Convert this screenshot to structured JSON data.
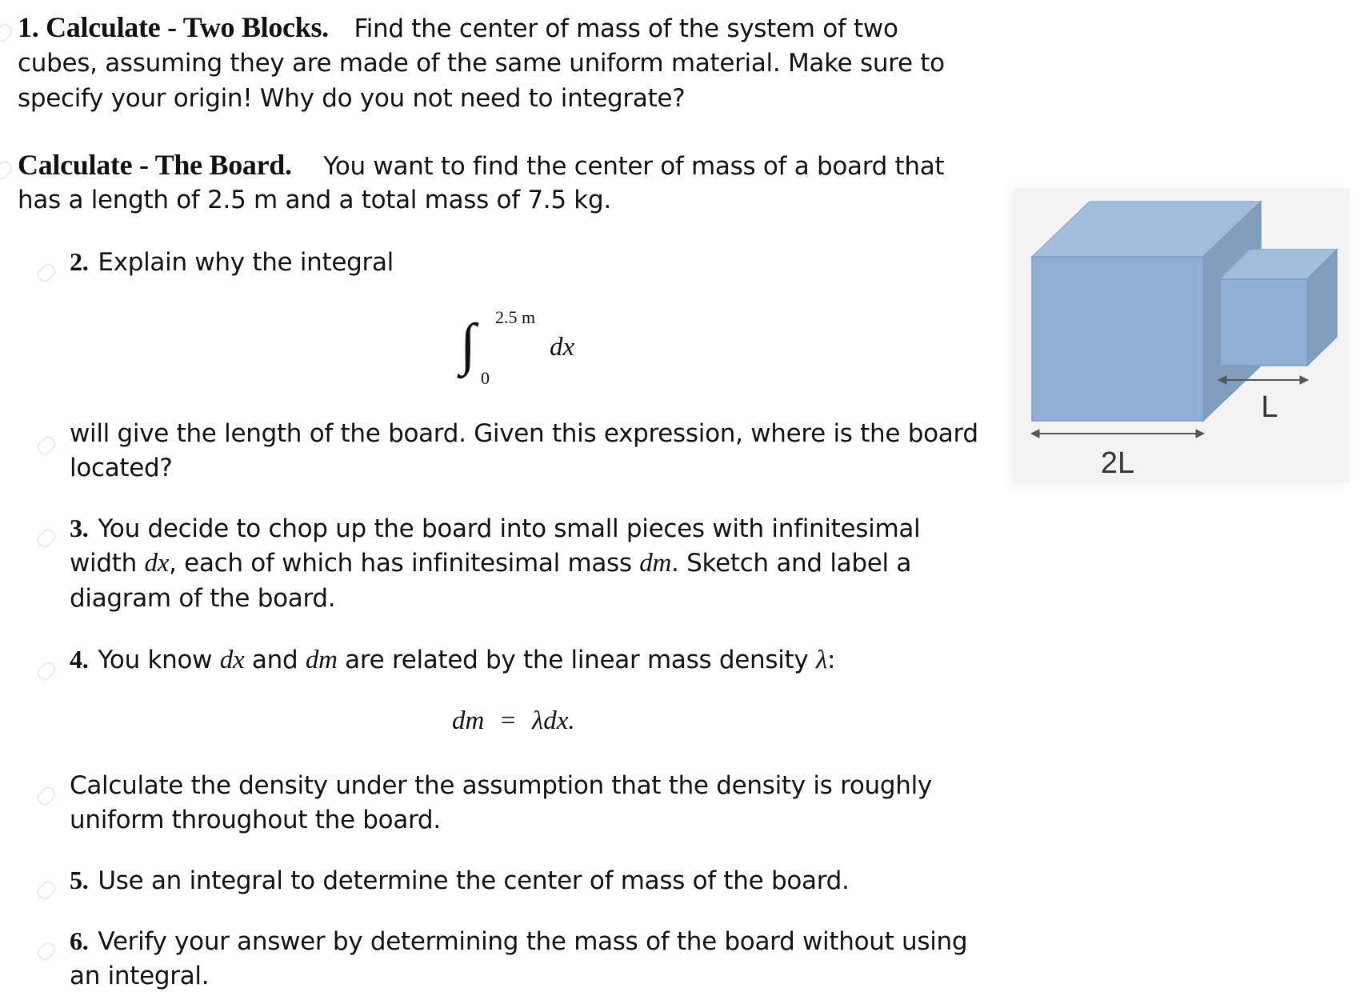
{
  "problem1": {
    "title": "1. Calculate - Two Blocks.",
    "lines": [
      "Find the center of mass of the system of two",
      "cubes, assuming they are made of the same uniform material. Make sure to",
      "specify your origin! Why do you not need to integrate?"
    ]
  },
  "board_section": {
    "title": "Calculate - The Board.",
    "lines": [
      "You want to find the center of mass of a board that",
      "has a length of 2.5 m and a total mass of 7.5 kg."
    ]
  },
  "q2": {
    "number": "2.",
    "text": "Explain why the integral",
    "integral_upper": "2.5 m",
    "integral_lower": "0",
    "integral_sign": "∫",
    "integrand": "dx",
    "follow_lines": [
      "will give the length of the board. Given this expression, where is the board",
      "located?"
    ]
  },
  "q3": {
    "number": "3.",
    "line1": "You decide to chop up the board into small pieces with infinitesimal",
    "line2_a": "width ",
    "line2_math1": "dx",
    "line2_b": ", each of which has infinitesimal mass ",
    "line2_math2": "dm",
    "line2_c": ". Sketch and label a",
    "line3": "diagram of the board."
  },
  "q4": {
    "number": "4.",
    "a": "You know ",
    "m1": "dx",
    "b": " and ",
    "m2": "dm",
    "c": " are related by the linear mass density ",
    "m3": "λ",
    "d": ":",
    "equation_lhs": "dm",
    "equation_eq": "=",
    "equation_rhs": "λdx.",
    "follow_lines": [
      "Calculate the density under the assumption that the density is roughly",
      "uniform throughout the board."
    ]
  },
  "q5": {
    "number": "5.",
    "text": "Use an integral to determine the center of mass of the board."
  },
  "q6": {
    "number": "6.",
    "lines": [
      "Verify your answer by determining the mass of the board without using",
      "an integral."
    ]
  },
  "figure": {
    "large_cube_label": "2L",
    "small_cube_label": "L",
    "colors": {
      "front": "#8fafd6",
      "top": "#a3bedd",
      "side": "#829dbd",
      "edge": "#7d9cc4",
      "arrow": "#555555",
      "card": "#f3f3f3"
    }
  }
}
